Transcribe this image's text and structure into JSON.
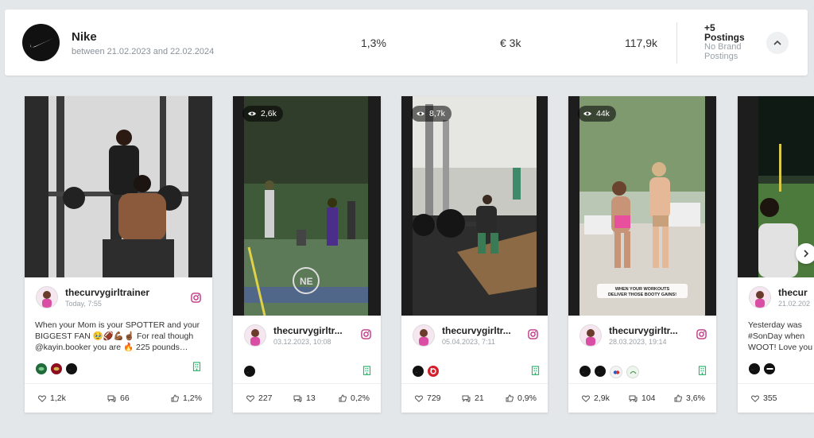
{
  "header": {
    "brand_name": "Nike",
    "date_range": "between 21.02.2023 and 22.02.2024",
    "engagement": "1,3%",
    "value": "€ 3k",
    "reach": "117,9k",
    "postings_count": "+5",
    "postings_label": "Postings",
    "no_brand_line1": "No Brand",
    "no_brand_line2": "Postings"
  },
  "cards": [
    {
      "username": "thecurvygirltrainer",
      "date": "Today, 7:55",
      "caption": "When your Mom is your SPOTTER and your BIGGEST FAN 🥹🏈💪🏾☝🏾 For real though @kayin.booker you are 🔥 225 pounds…",
      "likes": "1,2k",
      "comments": "66",
      "engagement": "1,2%"
    },
    {
      "views": "2,6k",
      "username": "thecurvygirltr...",
      "date": "03.12.2023, 10:08",
      "likes": "227",
      "comments": "13",
      "engagement": "0,2%"
    },
    {
      "views": "8,7k",
      "username": "thecurvygirltr...",
      "date": "05.04.2023, 7:11",
      "likes": "729",
      "comments": "21",
      "engagement": "0,9%"
    },
    {
      "views": "44k",
      "username": "thecurvygirltr...",
      "date": "28.03.2023, 19:14",
      "overlay_text": "WHEN YOUR WORKOUTS DELIVER THOSE BOOTY GAINS!",
      "likes": "2,9k",
      "comments": "104",
      "engagement": "3,6%"
    },
    {
      "username": "thecur",
      "date": "21.02.202",
      "caption": "Yesterday was #SonDay when WOOT! Love you",
      "likes": "355"
    }
  ],
  "colors": {
    "background": "#e3e7ea",
    "instagram": "#c13584",
    "company_icon": "#2eb872"
  }
}
